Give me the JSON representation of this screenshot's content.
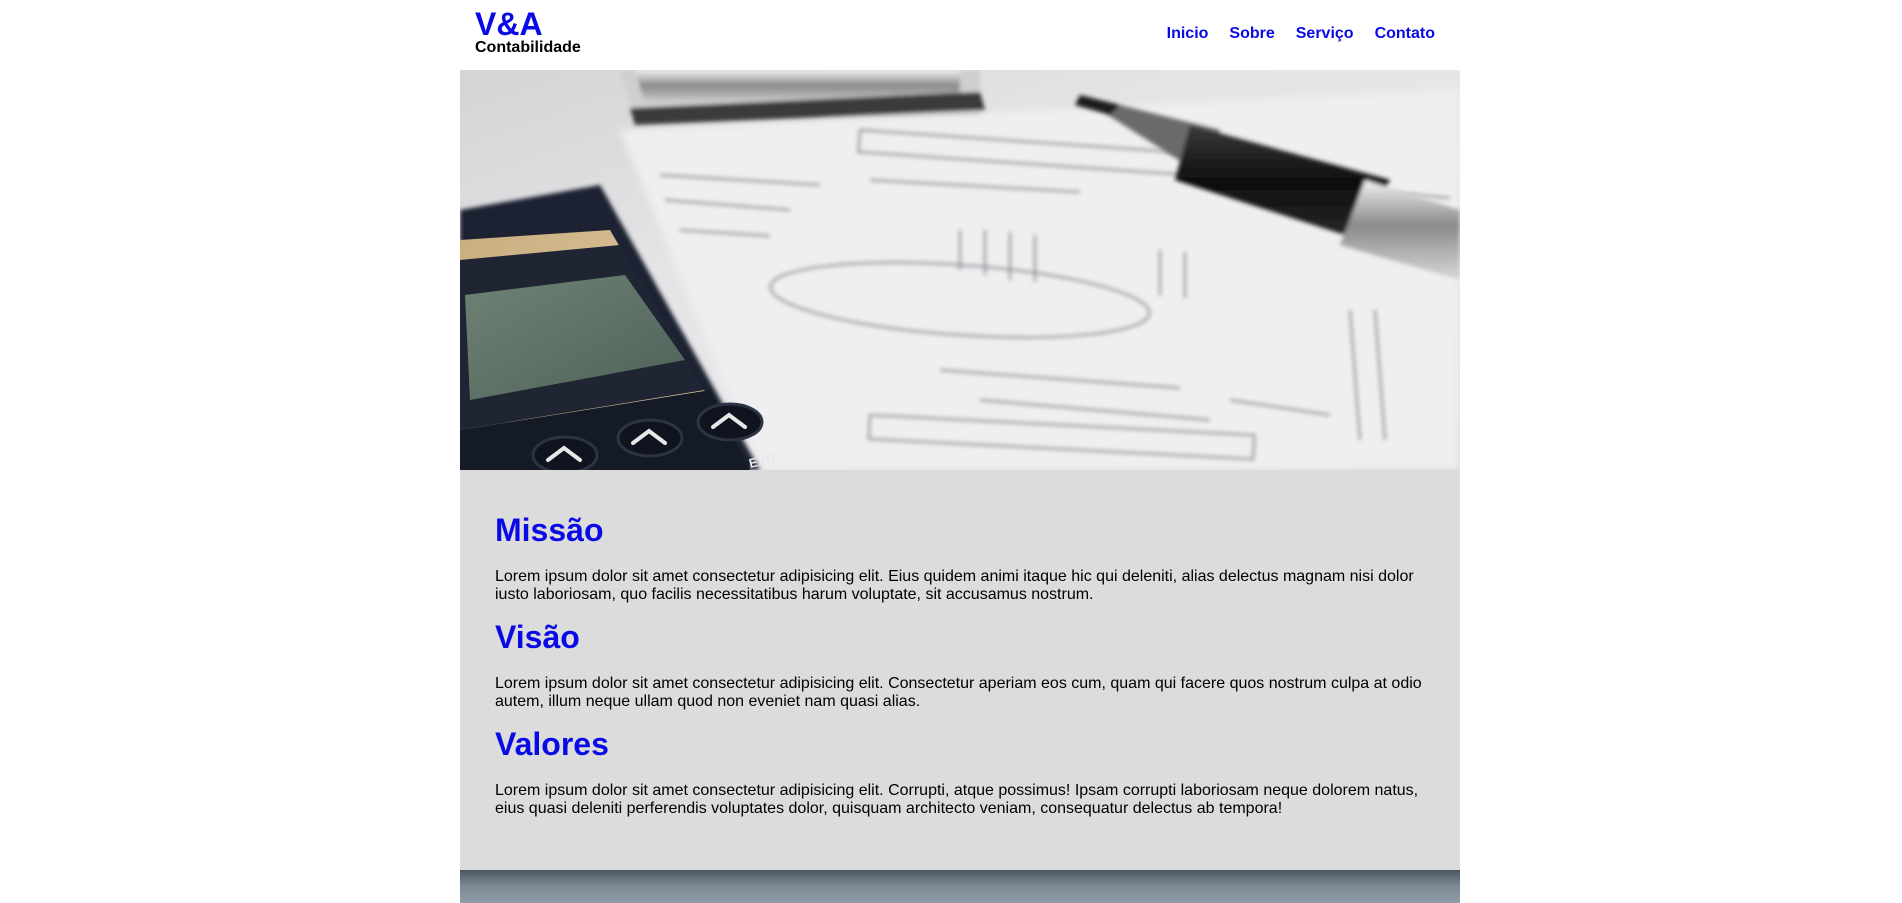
{
  "brand": {
    "title": "V&A",
    "subtitle": "Contabilidade",
    "accent_color": "#0a0ae6"
  },
  "nav": {
    "items": [
      {
        "label": "Inicio"
      },
      {
        "label": "Sobre"
      },
      {
        "label": "Serviço"
      },
      {
        "label": "Contato"
      }
    ]
  },
  "hero": {
    "image": "calculator-pen-documents-photo",
    "calculator_key_label": "EXIT"
  },
  "sections": [
    {
      "heading": "Missão",
      "text": "Lorem ipsum dolor sit amet consectetur adipisicing elit. Eius quidem animi itaque hic qui deleniti, alias delectus magnam nisi dolor iusto laboriosam, quo facilis necessitatibus harum voluptate, sit accusamus nostrum."
    },
    {
      "heading": "Visão",
      "text": "Lorem ipsum dolor sit amet consectetur adipisicing elit. Consectetur aperiam eos cum, quam qui facere quos nostrum culpa at odio autem, illum neque ullam quod non eveniet nam quasi alias."
    },
    {
      "heading": "Valores",
      "text": "Lorem ipsum dolor sit amet consectetur adipisicing elit. Corrupti, atque possimus! Ipsam corrupti laboriosam neque dolorem natus, eius quasi deleniti perferendis voluptates dolor, quisquam architecto veniam, consequatur delectus ab tempora!"
    }
  ],
  "colors": {
    "content_background": "#dcdcdc",
    "page_background": "#ffffff"
  }
}
